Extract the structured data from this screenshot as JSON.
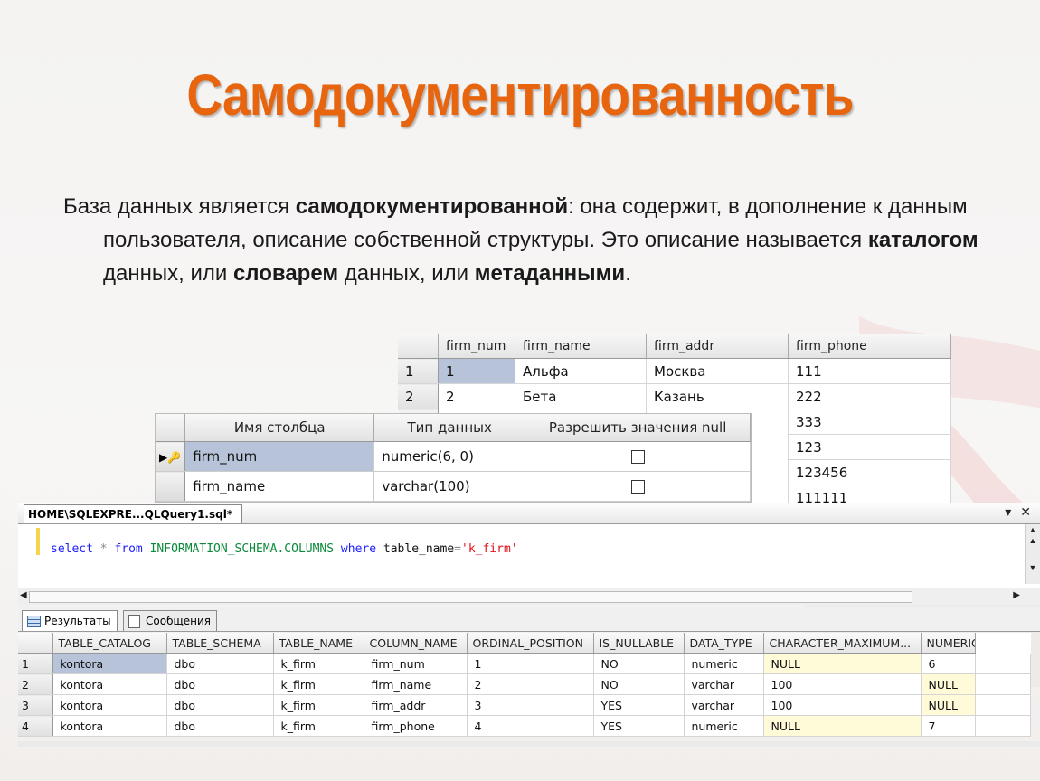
{
  "slide": {
    "title": "Самодокументированность",
    "paragraph": [
      {
        "t": "База данных является ",
        "b": false
      },
      {
        "t": "самодокументированной",
        "b": true
      },
      {
        "t": ": она содержит, в дополнение к данным пользователя, описание собственной структуры. Это описание называется ",
        "b": false
      },
      {
        "t": "каталогом",
        "b": true
      },
      {
        "t": " данных, или ",
        "b": false
      },
      {
        "t": "словарем",
        "b": true
      },
      {
        "t": " данных, или ",
        "b": false
      },
      {
        "t": "метаданными",
        "b": true
      },
      {
        "t": ".",
        "b": false
      }
    ]
  },
  "firm_grid": {
    "columns": [
      "firm_num",
      "firm_name",
      "firm_addr",
      "firm_phone"
    ],
    "rows": [
      {
        "rh": "1",
        "cells": [
          "1",
          "Альфа",
          "Москва",
          "111"
        ]
      },
      {
        "rh": "2",
        "cells": [
          "2",
          "Бета",
          "Казань",
          "222"
        ]
      },
      {
        "rh": "",
        "cells": [
          "",
          "",
          "",
          "333"
        ]
      },
      {
        "rh": "",
        "cells": [
          "",
          "",
          "",
          "123"
        ]
      },
      {
        "rh": "",
        "cells": [
          "",
          "",
          "",
          "123456"
        ]
      },
      {
        "rh": "",
        "cells": [
          "",
          "",
          "",
          "111111"
        ]
      }
    ]
  },
  "design_grid": {
    "columns": [
      "Имя столбца",
      "Тип данных",
      "Разрешить значения null"
    ],
    "rows": [
      {
        "name": "firm_num",
        "type": "numeric(6, 0)",
        "allow_null": false,
        "primary_key": true
      },
      {
        "name": "firm_name",
        "type": "varchar(100)",
        "allow_null": false,
        "primary_key": false
      }
    ]
  },
  "editor": {
    "tab_title": "HOME\\SQLEXPRE...QLQuery1.sql*",
    "query": {
      "kw1": "select",
      "op1": " * ",
      "kw2": "from",
      "obj": "INFORMATION_SCHEMA.COLUMNS",
      "kw3": "where",
      "col": "table_name",
      "op2": "=",
      "str": "'k_firm'"
    }
  },
  "results": {
    "tabs": [
      "Результаты",
      "Сообщения"
    ],
    "columns": [
      "TABLE_CATALOG",
      "TABLE_SCHEMA",
      "TABLE_NAME",
      "COLUMN_NAME",
      "ORDINAL_POSITION",
      "IS_NULLABLE",
      "DATA_TYPE",
      "CHARACTER_MAXIMUM...",
      "NUMERIC_PRECI"
    ],
    "rows": [
      {
        "rh": "1",
        "cells": [
          "kontora",
          "dbo",
          "k_firm",
          "firm_num",
          "1",
          "NO",
          "numeric",
          "NULL",
          "6"
        ]
      },
      {
        "rh": "2",
        "cells": [
          "kontora",
          "dbo",
          "k_firm",
          "firm_name",
          "2",
          "NO",
          "varchar",
          "100",
          "NULL"
        ]
      },
      {
        "rh": "3",
        "cells": [
          "kontora",
          "dbo",
          "k_firm",
          "firm_addr",
          "3",
          "YES",
          "varchar",
          "100",
          "NULL"
        ]
      },
      {
        "rh": "4",
        "cells": [
          "kontora",
          "dbo",
          "k_firm",
          "firm_phone",
          "4",
          "YES",
          "numeric",
          "NULL",
          "7"
        ]
      }
    ]
  }
}
